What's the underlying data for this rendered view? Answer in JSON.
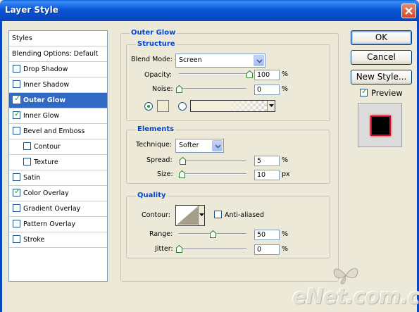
{
  "window": {
    "title": "Layer Style"
  },
  "styles_list": {
    "items": [
      {
        "label": "Styles",
        "checkbox": false,
        "checked": false,
        "indent": 0,
        "selected": false
      },
      {
        "label": "Blending Options: Default",
        "checkbox": false,
        "checked": false,
        "indent": 0,
        "selected": false
      },
      {
        "label": "Drop Shadow",
        "checkbox": true,
        "checked": false,
        "indent": 0,
        "selected": false
      },
      {
        "label": "Inner Shadow",
        "checkbox": true,
        "checked": false,
        "indent": 0,
        "selected": false
      },
      {
        "label": "Outer Glow",
        "checkbox": true,
        "checked": true,
        "indent": 0,
        "selected": true
      },
      {
        "label": "Inner Glow",
        "checkbox": true,
        "checked": true,
        "indent": 0,
        "selected": false
      },
      {
        "label": "Bevel and Emboss",
        "checkbox": true,
        "checked": false,
        "indent": 0,
        "selected": false
      },
      {
        "label": "Contour",
        "checkbox": true,
        "checked": false,
        "indent": 1,
        "selected": false
      },
      {
        "label": "Texture",
        "checkbox": true,
        "checked": false,
        "indent": 1,
        "selected": false
      },
      {
        "label": "Satin",
        "checkbox": true,
        "checked": false,
        "indent": 0,
        "selected": false
      },
      {
        "label": "Color Overlay",
        "checkbox": true,
        "checked": true,
        "indent": 0,
        "selected": false
      },
      {
        "label": "Gradient Overlay",
        "checkbox": true,
        "checked": false,
        "indent": 0,
        "selected": false
      },
      {
        "label": "Pattern Overlay",
        "checkbox": true,
        "checked": false,
        "indent": 0,
        "selected": false
      },
      {
        "label": "Stroke",
        "checkbox": true,
        "checked": false,
        "indent": 0,
        "selected": false
      }
    ]
  },
  "outer_glow": {
    "title": "Outer Glow",
    "structure": {
      "title": "Structure",
      "blend_mode_label": "Blend Mode:",
      "blend_mode_value": "Screen",
      "opacity_label": "Opacity:",
      "opacity_value": "100",
      "opacity_level": 1.0,
      "noise_label": "Noise:",
      "noise_value": "0",
      "noise_level": 0.0,
      "unit": "%",
      "solid_color_selected": true,
      "glow_color": "#f0ebd2"
    },
    "elements": {
      "title": "Elements",
      "technique_label": "Technique:",
      "technique_value": "Softer",
      "spread_label": "Spread:",
      "spread_value": "5",
      "spread_level": 0.05,
      "spread_unit": "%",
      "size_label": "Size:",
      "size_value": "10",
      "size_level": 0.04,
      "size_unit": "px"
    },
    "quality": {
      "title": "Quality",
      "contour_label": "Contour:",
      "anti_aliased_label": "Anti-aliased",
      "anti_aliased_checked": false,
      "range_label": "Range:",
      "range_value": "50",
      "range_level": 0.5,
      "range_unit": "%",
      "jitter_label": "Jitter:",
      "jitter_value": "0",
      "jitter_level": 0.0,
      "jitter_unit": "%"
    }
  },
  "buttons": {
    "ok": "OK",
    "cancel": "Cancel",
    "new_style": "New Style..."
  },
  "preview": {
    "label": "Preview",
    "checked": true
  },
  "watermark": {
    "text": "eNet.com.cn"
  },
  "colors": {
    "accent": "#0046d5",
    "selection": "#316ac5",
    "check": "#21a121",
    "preview_glow": "#d10a2a"
  }
}
